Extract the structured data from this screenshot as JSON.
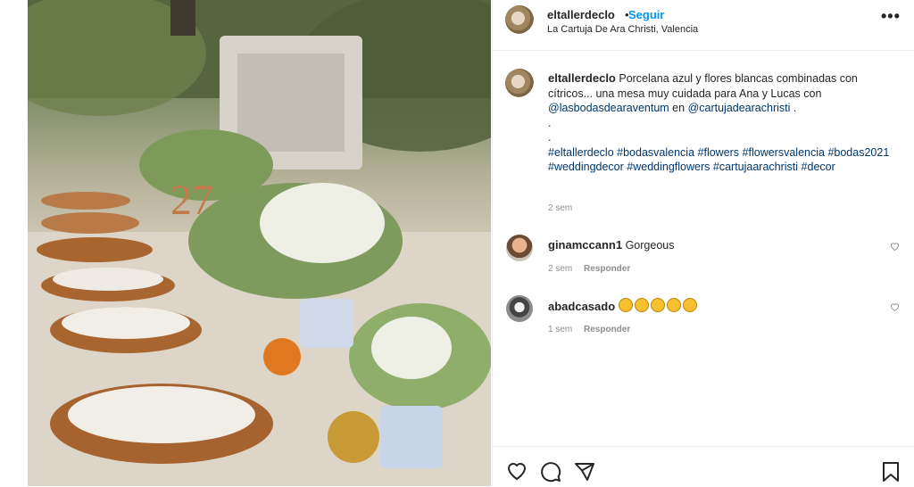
{
  "post": {
    "username": "eltallerdeclo",
    "follow_separator": "•",
    "follow_label": "Seguir",
    "location": "La Cartuja De Ara Christi, Valencia",
    "more_label": "•••"
  },
  "caption": {
    "username": "eltallerdeclo",
    "text": "Porcelana azul y flores blancas combinadas con cítricos... una mesa muy cuidada para Ana y Lucas con",
    "mention1": "@lasbodasdearaventum",
    "connector": "en",
    "mention2": "@cartujadearachristi",
    "end": ".",
    "dot1": ".",
    "dot2": ".",
    "hashtags": [
      "#eltallerdeclo",
      "#bodasvalencia",
      "#flowers",
      "#flowersvalencia",
      "#bodas2021",
      "#weddingdecor",
      "#weddingflowers",
      "#cartujaarachristi",
      "#decor"
    ],
    "time": "2 sem"
  },
  "comments": [
    {
      "username": "ginamccann1",
      "text": "Gorgeous",
      "time": "2 sem",
      "reply": "Responder"
    },
    {
      "username": "abadcasado",
      "text": "",
      "claps": 5,
      "time": "1 sem",
      "reply": "Responder"
    }
  ],
  "icons": [
    "heart-icon",
    "comment-icon",
    "share-icon",
    "bookmark-icon",
    "more-icon"
  ],
  "colors": {
    "link": "#0095f6",
    "hashtag": "#00376b",
    "muted": "#8e8e8e"
  }
}
